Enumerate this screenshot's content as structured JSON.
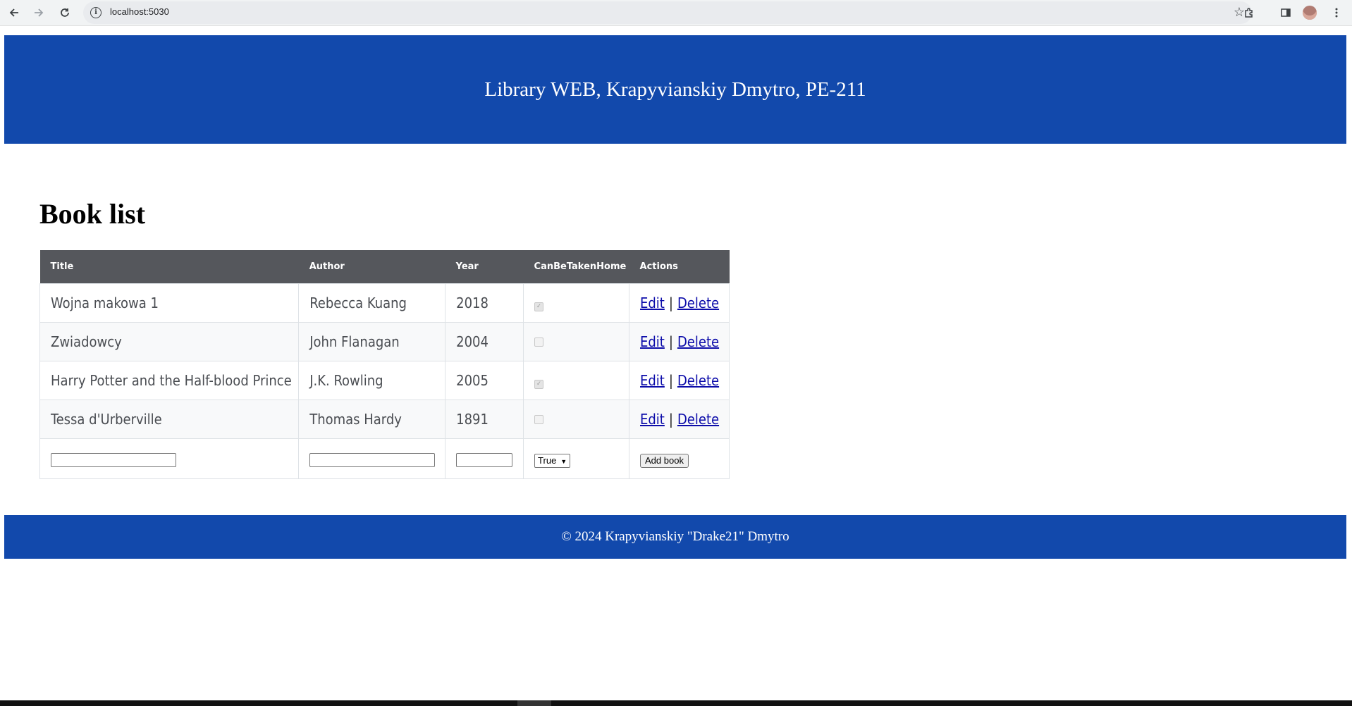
{
  "browser": {
    "url": "localhost:5030",
    "icons": {
      "back": "arrow-left-icon",
      "forward": "arrow-right-icon",
      "reload": "reload-icon",
      "info": "info-icon",
      "bookmark": "star-icon",
      "extensions": "puzzle-icon",
      "side_panel": "side-panel-icon",
      "profile": "avatar",
      "menu": "kebab-menu-icon"
    }
  },
  "header": {
    "title": "Library WEB, Krapyvianskiy Dmytro, PE-211"
  },
  "main": {
    "heading": "Book list",
    "columns": [
      "Title",
      "Author",
      "Year",
      "CanBeTakenHome",
      "Actions"
    ],
    "rows": [
      {
        "title": "Wojna makowa 1",
        "author": "Rebecca Kuang",
        "year": "2018",
        "can_be_taken_home": true
      },
      {
        "title": "Zwiadowcy",
        "author": "John Flanagan",
        "year": "2004",
        "can_be_taken_home": false
      },
      {
        "title": "Harry Potter and the Half-blood Prince",
        "author": "J.K. Rowling",
        "year": "2005",
        "can_be_taken_home": true
      },
      {
        "title": "Tessa d'Urberville",
        "author": "Thomas Hardy",
        "year": "1891",
        "can_be_taken_home": false
      }
    ],
    "actions": {
      "edit": "Edit",
      "separator": "|",
      "delete": "Delete"
    },
    "form": {
      "title_value": "",
      "author_value": "",
      "year_value": "",
      "can_be_taken_home_selected": "True",
      "add_button": "Add book"
    }
  },
  "footer": {
    "text": "© 2024 Krapyvianskiy \"Drake21\" Dmytro"
  },
  "colors": {
    "brand_blue": "#1249ac",
    "table_header": "#55575c",
    "link": "#0d0daa"
  }
}
